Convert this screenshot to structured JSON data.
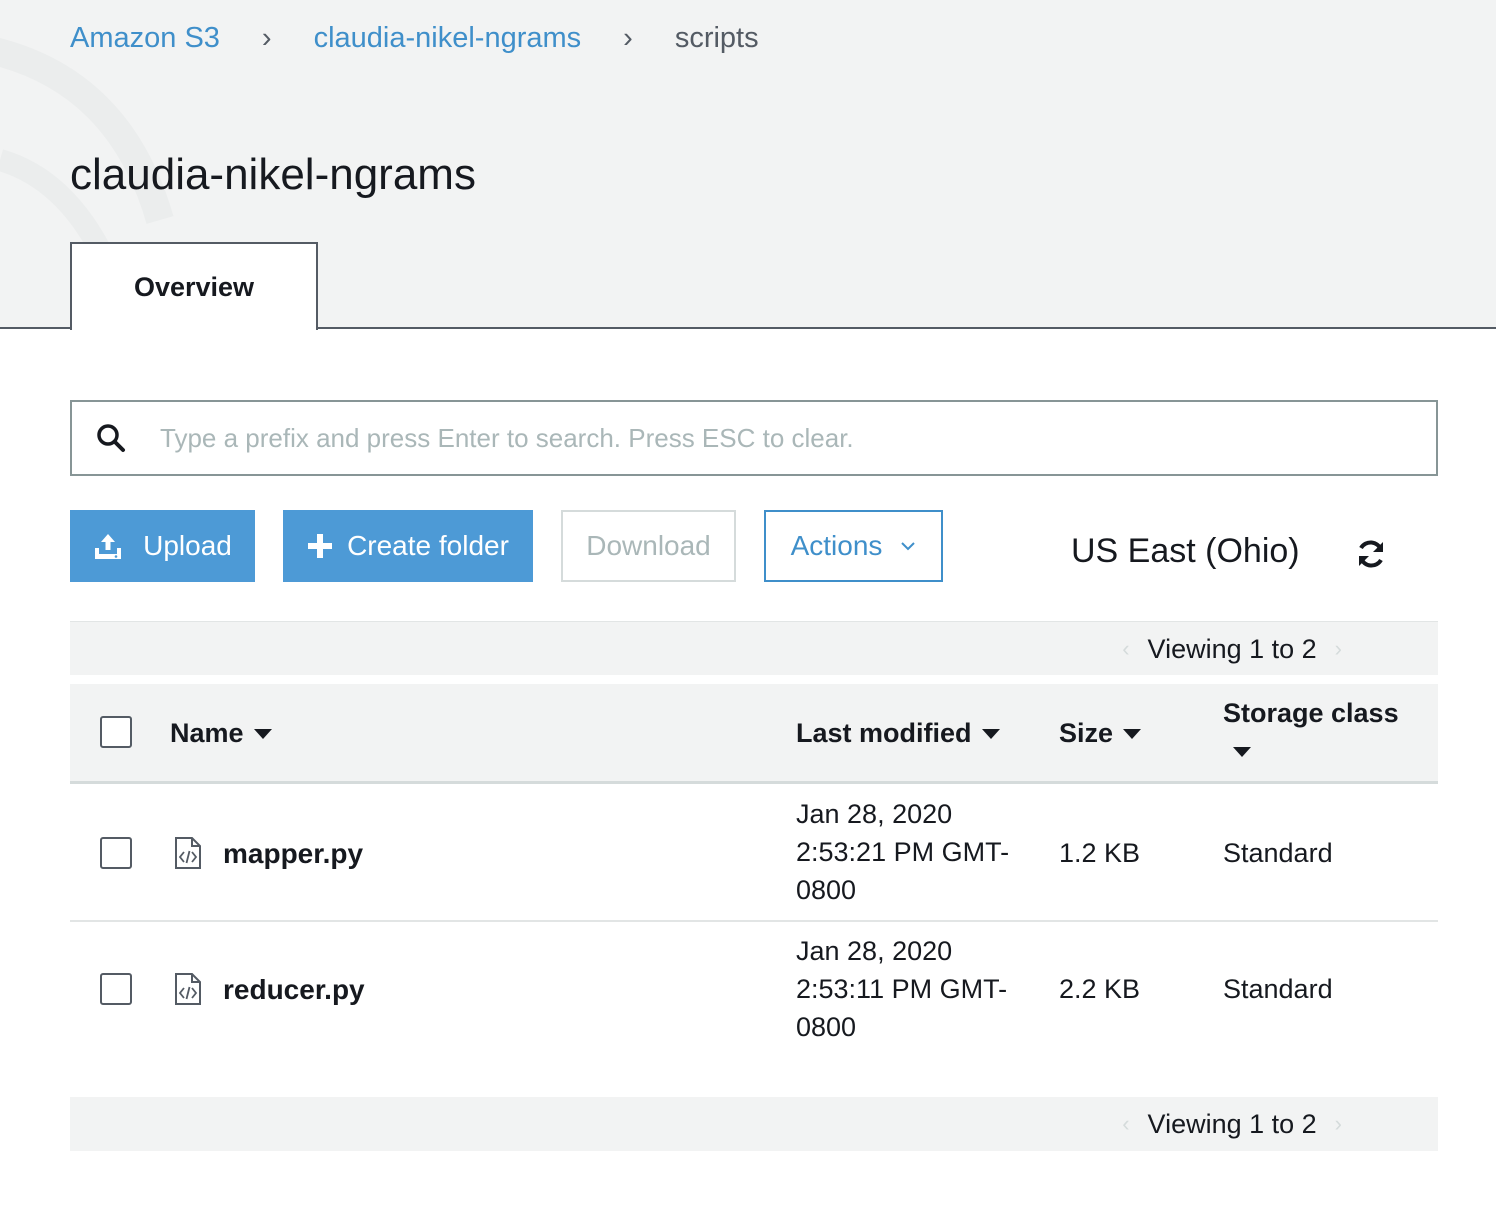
{
  "breadcrumb": {
    "items": [
      "Amazon S3",
      "claudia-nikel-ngrams"
    ],
    "current": "scripts",
    "separator": "›"
  },
  "page": {
    "title": "claudia-nikel-ngrams"
  },
  "tabs": [
    {
      "label": "Overview",
      "active": true
    }
  ],
  "search": {
    "placeholder": "Type a prefix and press Enter to search. Press ESC to clear.",
    "value": ""
  },
  "toolbar": {
    "upload_label": "Upload",
    "create_folder_label": "Create folder",
    "download_label": "Download",
    "actions_label": "Actions",
    "region": "US East (Ohio)"
  },
  "pager": {
    "text": "Viewing 1 to 2"
  },
  "table": {
    "columns": [
      "Name",
      "Last modified",
      "Size",
      "Storage class"
    ],
    "rows": [
      {
        "name": "mapper.py",
        "date_line1": "Jan 28, 2020",
        "date_line2": "2:53:21 PM GMT-",
        "date_line3": "0800",
        "size": "1.2 KB",
        "storage_class": "Standard"
      },
      {
        "name": "reducer.py",
        "date_line1": "Jan 28, 2020",
        "date_line2": "2:53:11 PM GMT-",
        "date_line3": "0800",
        "size": "2.2 KB",
        "storage_class": "Standard"
      }
    ]
  },
  "colors": {
    "link": "#3f8fca",
    "primary_button": "#4d9ad6",
    "header_bg": "#f2f3f3",
    "disabled_text": "#aab7b8"
  },
  "icons": [
    "search-icon",
    "upload-icon",
    "plus-icon",
    "chevron-down-icon",
    "refresh-icon",
    "code-file-icon"
  ]
}
